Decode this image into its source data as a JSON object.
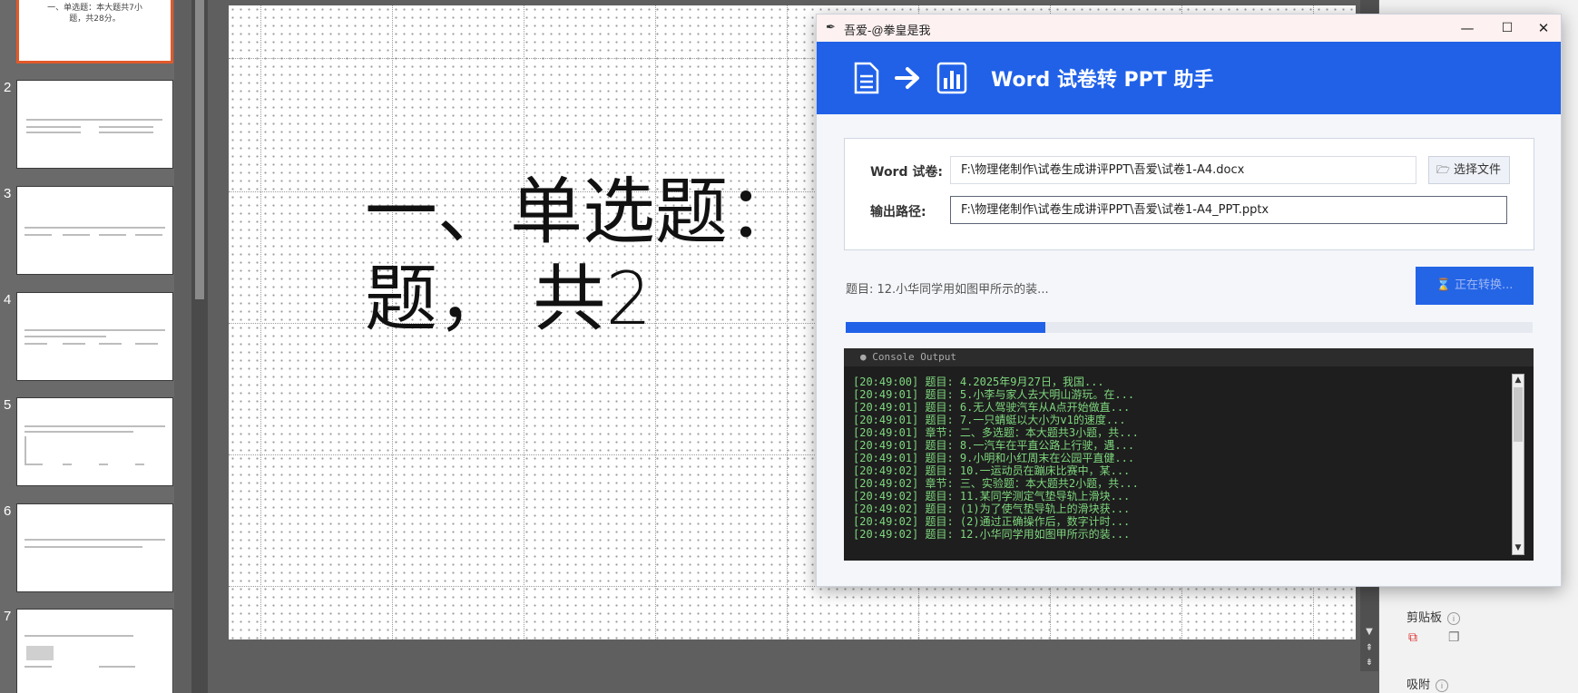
{
  "thumbnails": [
    {
      "num": "",
      "text": "一、单选题：本大题共7小\n题，共28分。",
      "active": true
    },
    {
      "num": "2",
      "text": "",
      "active": false
    },
    {
      "num": "3",
      "text": "",
      "active": false
    },
    {
      "num": "4",
      "text": "",
      "active": false
    },
    {
      "num": "5",
      "text": "",
      "active": false
    },
    {
      "num": "6",
      "text": "",
      "active": false
    },
    {
      "num": "7",
      "text": "",
      "active": false
    }
  ],
  "slide": {
    "title": "一、单选题：\n题， 共2"
  },
  "right_pane": {
    "clipboard_label": "剪贴板",
    "snap_label": "吸附"
  },
  "app": {
    "window_title": "吾爱-@拳皇是我",
    "banner_title": "Word 试卷转 PPT 助手",
    "colors": {
      "accent": "#2061e8",
      "console_text": "#7fd87f"
    },
    "icons": [
      "document-icon",
      "arrow-right-icon",
      "chart-icon",
      "folder-icon"
    ],
    "form": {
      "word_label": "Word 试卷:",
      "word_path": "F:\\物理佬制作\\试卷生成讲评PPT\\吾爱\\试卷1-A4.docx",
      "browse_label": "选择文件",
      "output_label": "输出路径:",
      "output_path": "F:\\物理佬制作\\试卷生成讲评PPT\\吾爱\\试卷1-A4_PPT.pptx"
    },
    "status": "题目: 12.小华同学用如图甲所示的装...",
    "convert_button": "正在转换...",
    "progress": 0.29,
    "console": {
      "header": "● Console Output",
      "lines": [
        "[20:49:00] 题目: 4.2025年9月27日，我国...",
        "[20:49:01] 题目: 5.小李与家人去大明山游玩。在...",
        "[20:49:01] 题目: 6.无人驾驶汽车从A点开始做直...",
        "[20:49:01] 题目: 7.一只蜻蜓以大小为v1的速度...",
        "[20:49:01] 章节: 二、多选题：本大题共3小题，共...",
        "[20:49:01] 题目: 8.一汽车在平直公路上行驶，遇...",
        "[20:49:01] 题目: 9.小明和小红周末在公园平直健...",
        "[20:49:02] 题目: 10.一运动员在蹦床比赛中，某...",
        "[20:49:02] 章节: 三、实验题：本大题共2小题，共...",
        "[20:49:02] 题目: 11.某同学测定气垫导轨上滑块...",
        "[20:49:02] 题目: (1)为了使气垫导轨上的滑块获...",
        "[20:49:02] 题目: (2)通过正确操作后，数字计时...",
        "[20:49:02] 题目: 12.小华同学用如图甲所示的装..."
      ]
    }
  }
}
